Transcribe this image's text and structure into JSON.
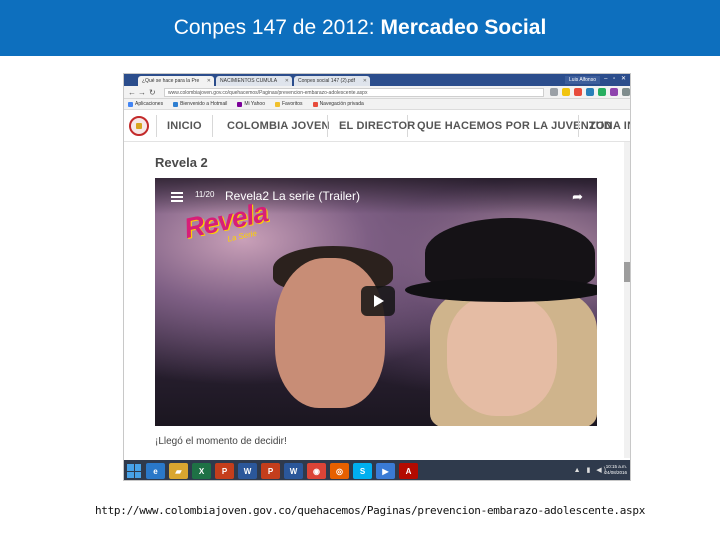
{
  "slide": {
    "title_normal": "Conpes 147 de 2012:",
    "title_bold": "Mercadeo Social",
    "footer_url": "http://www.colombiajoven.gov.co/quehacemos/Paginas/prevencion-embarazo-adolescente.aspx"
  },
  "browser": {
    "tabs": [
      {
        "label": "¿Qué se hace para la Pre"
      },
      {
        "label": "NACIMIENTOS CUMULA"
      },
      {
        "label": "Conpes social 147 (2).pdf"
      }
    ],
    "user_label": "Luis Alfonso",
    "window_controls": "– ▫ ✕",
    "url": "www.colombiajoven.gov.co/quehacemos/Paginas/prevencion-embarazo-adolescente.aspx",
    "bookmarks": [
      {
        "label": "Aplicaciones",
        "color": "#4285f4"
      },
      {
        "label": "Bienvenido a Hotmail",
        "color": "#2f7fd1"
      },
      {
        "label": "Mi Yahoo",
        "color": "#7b0099"
      },
      {
        "label": "Favoritos",
        "color": "#f0c02c"
      },
      {
        "label": "Navegación privada",
        "color": "#e74c3c"
      }
    ]
  },
  "site": {
    "nav": [
      {
        "label": "INICIO"
      },
      {
        "label": "COLOMBIA JOVEN"
      },
      {
        "label": "EL DIRECTOR"
      },
      {
        "label": "QUE HACEMOS POR LA JUVENTUD"
      },
      {
        "label": "ZONA IN"
      }
    ],
    "page_title": "Revela 2",
    "caption": "¡Llegó el momento de decidir!"
  },
  "video": {
    "counter": "11/20",
    "title": "Revela2 La serie (Trailer)",
    "logo_text": "Revela",
    "logo_sub": "La Serie"
  },
  "taskbar": {
    "icons": [
      {
        "name": "ie-icon",
        "glyph": "e",
        "color": "#2a78c8"
      },
      {
        "name": "folder-icon",
        "glyph": "▰",
        "color": "#d9a630"
      },
      {
        "name": "excel-icon",
        "glyph": "X",
        "color": "#1e7145"
      },
      {
        "name": "powerpoint-icon",
        "glyph": "P",
        "color": "#c43e1c"
      },
      {
        "name": "word-icon",
        "glyph": "W",
        "color": "#2b579a"
      },
      {
        "name": "powerpoint2-icon",
        "glyph": "P",
        "color": "#c43e1c"
      },
      {
        "name": "word2-icon",
        "glyph": "W",
        "color": "#2b579a"
      },
      {
        "name": "chrome-icon",
        "glyph": "◉",
        "color": "#db4437"
      },
      {
        "name": "firefox-icon",
        "glyph": "◎",
        "color": "#e66000"
      },
      {
        "name": "skype-icon",
        "glyph": "S",
        "color": "#00aff0"
      },
      {
        "name": "media-icon",
        "glyph": "▶",
        "color": "#3a7bd5"
      },
      {
        "name": "pdf-icon",
        "glyph": "A",
        "color": "#b30b00"
      }
    ],
    "clock_time": "10:15 a.m.",
    "clock_date": "24/08/2016"
  }
}
